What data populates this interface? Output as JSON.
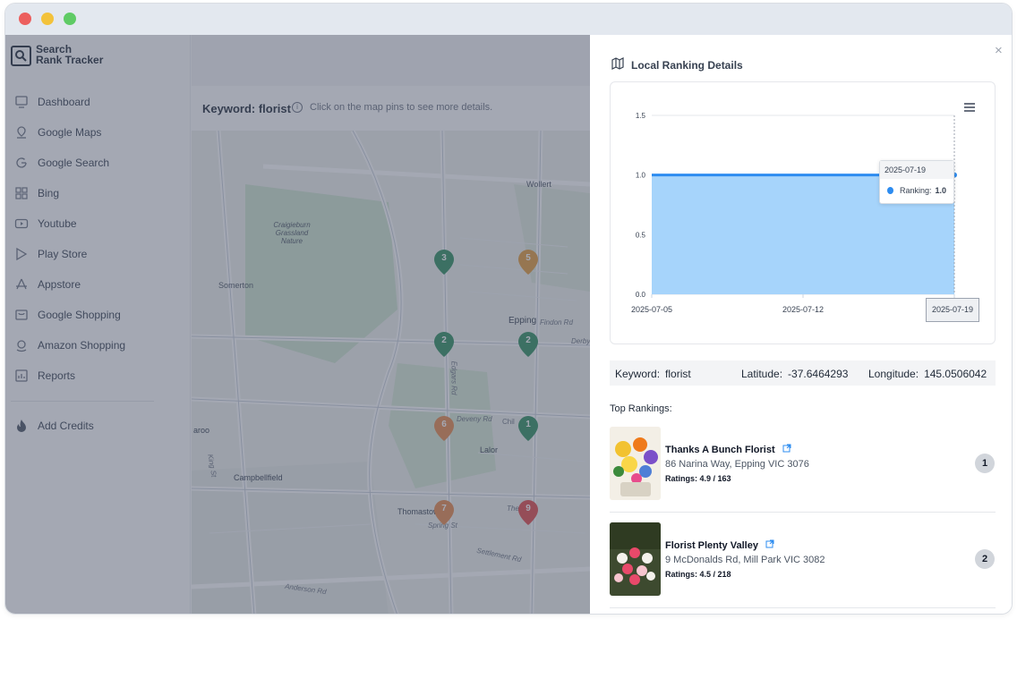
{
  "brand": {
    "line1": "Search",
    "line2": "Rank Tracker"
  },
  "sidebar": {
    "items": [
      {
        "label": "Dashboard",
        "icon": "dashboard-icon"
      },
      {
        "label": "Google Maps",
        "icon": "map-pin-icon"
      },
      {
        "label": "Google Search",
        "icon": "google-icon"
      },
      {
        "label": "Bing",
        "icon": "bing-icon"
      },
      {
        "label": "Youtube",
        "icon": "youtube-icon"
      },
      {
        "label": "Play Store",
        "icon": "play-store-icon"
      },
      {
        "label": "Appstore",
        "icon": "appstore-icon"
      },
      {
        "label": "Google Shopping",
        "icon": "shopping-icon"
      },
      {
        "label": "Amazon Shopping",
        "icon": "amazon-icon"
      },
      {
        "label": "Reports",
        "icon": "reports-icon"
      }
    ],
    "credits": {
      "label": "Add Credits",
      "icon": "flame-icon"
    }
  },
  "main": {
    "keyword_title": "Keyword: florist",
    "hint": "Click on the map pins to see more details.",
    "map": {
      "places": [
        "Wollert",
        "Craigieburn Grassland Nature",
        "Somerton",
        "Epping",
        "Findon Rd",
        "Derby",
        "Lalor",
        "Deveny Rd",
        "Chil",
        "Edgars Rd",
        "aroo",
        "Campbellfield",
        "King St",
        "Thomastown",
        "Spring St",
        "The",
        "Settlement Rd",
        "Anderson Rd"
      ],
      "pins": [
        {
          "rank": "3",
          "color": "#2f8f5f"
        },
        {
          "rank": "5",
          "color": "#e29b3a"
        },
        {
          "rank": "2",
          "color": "#2f8f5f"
        },
        {
          "rank": "2",
          "color": "#2f8f5f"
        },
        {
          "rank": "6",
          "color": "#e6884a"
        },
        {
          "rank": "1",
          "color": "#2f8f5f"
        },
        {
          "rank": "7",
          "color": "#e6884a"
        },
        {
          "rank": "9",
          "color": "#e04848"
        }
      ]
    }
  },
  "panel": {
    "title": "Local Ranking Details",
    "close": "×",
    "tooltip": {
      "date": "2025-07-19",
      "series": "Ranking:",
      "value": "1.0"
    },
    "x_tooltip": "2025-07-19",
    "info": {
      "keyword_label": "Keyword:",
      "keyword": "florist",
      "lat_label": "Latitude:",
      "lat": "-37.6464293",
      "lon_label": "Longitude:",
      "lon": "145.0506042"
    },
    "top_label": "Top Rankings:",
    "rankings": [
      {
        "name": "Thanks A Bunch Florist",
        "address": "86 Narina Way, Epping VIC 3076",
        "rating": "Ratings: 4.9 / 163",
        "rank": "1"
      },
      {
        "name": "Florist Plenty Valley",
        "address": "9 McDonalds Rd, Mill Park VIC 3082",
        "rating": "Ratings: 4.5 / 218",
        "rank": "2"
      }
    ]
  },
  "chart_data": {
    "type": "area",
    "x": [
      "2025-07-05",
      "2025-07-12",
      "2025-07-19"
    ],
    "series": [
      {
        "name": "Ranking",
        "values": [
          1.0,
          1.0,
          1.0
        ],
        "color": "#2d8cf0"
      }
    ],
    "yticks": [
      "0.0",
      "0.5",
      "1.0",
      "1.5"
    ],
    "ylim": [
      0,
      1.5
    ],
    "grid": true
  }
}
